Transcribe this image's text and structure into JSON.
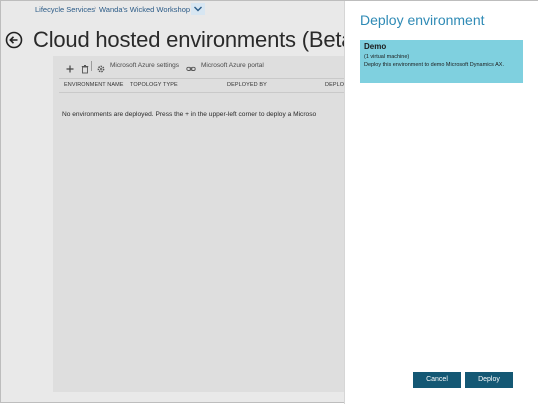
{
  "breadcrumb": {
    "root": "Lifecycle Services",
    "separator": "›",
    "project": "Wanda's Wicked Workshop"
  },
  "page": {
    "title": "Cloud hosted environments (Beta)"
  },
  "toolbar": {
    "add_icon": "plus-icon",
    "delete_icon": "trash-icon",
    "azure_settings_label": "Microsoft Azure settings",
    "azure_portal_label": "Microsoft Azure portal"
  },
  "table": {
    "columns": [
      "ENVIRONMENT NAME",
      "TOPOLOGY TYPE",
      "DEPLOYED BY",
      "DEPLOY"
    ],
    "empty_message": "No environments are deployed. Press the + in the upper-left corner to deploy a Microso"
  },
  "flyout": {
    "title": "Deploy environment",
    "selected_item": {
      "name": "Demo",
      "subtitle": "(1 virtual machine)",
      "description": "Deploy this environment to demo Microsoft Dynamics AX."
    },
    "cancel_label": "Cancel",
    "deploy_label": "Deploy"
  },
  "colors": {
    "accent": "#2e8ab5",
    "card": "#7fd0df",
    "button": "#145874",
    "link": "#2b5b87"
  }
}
